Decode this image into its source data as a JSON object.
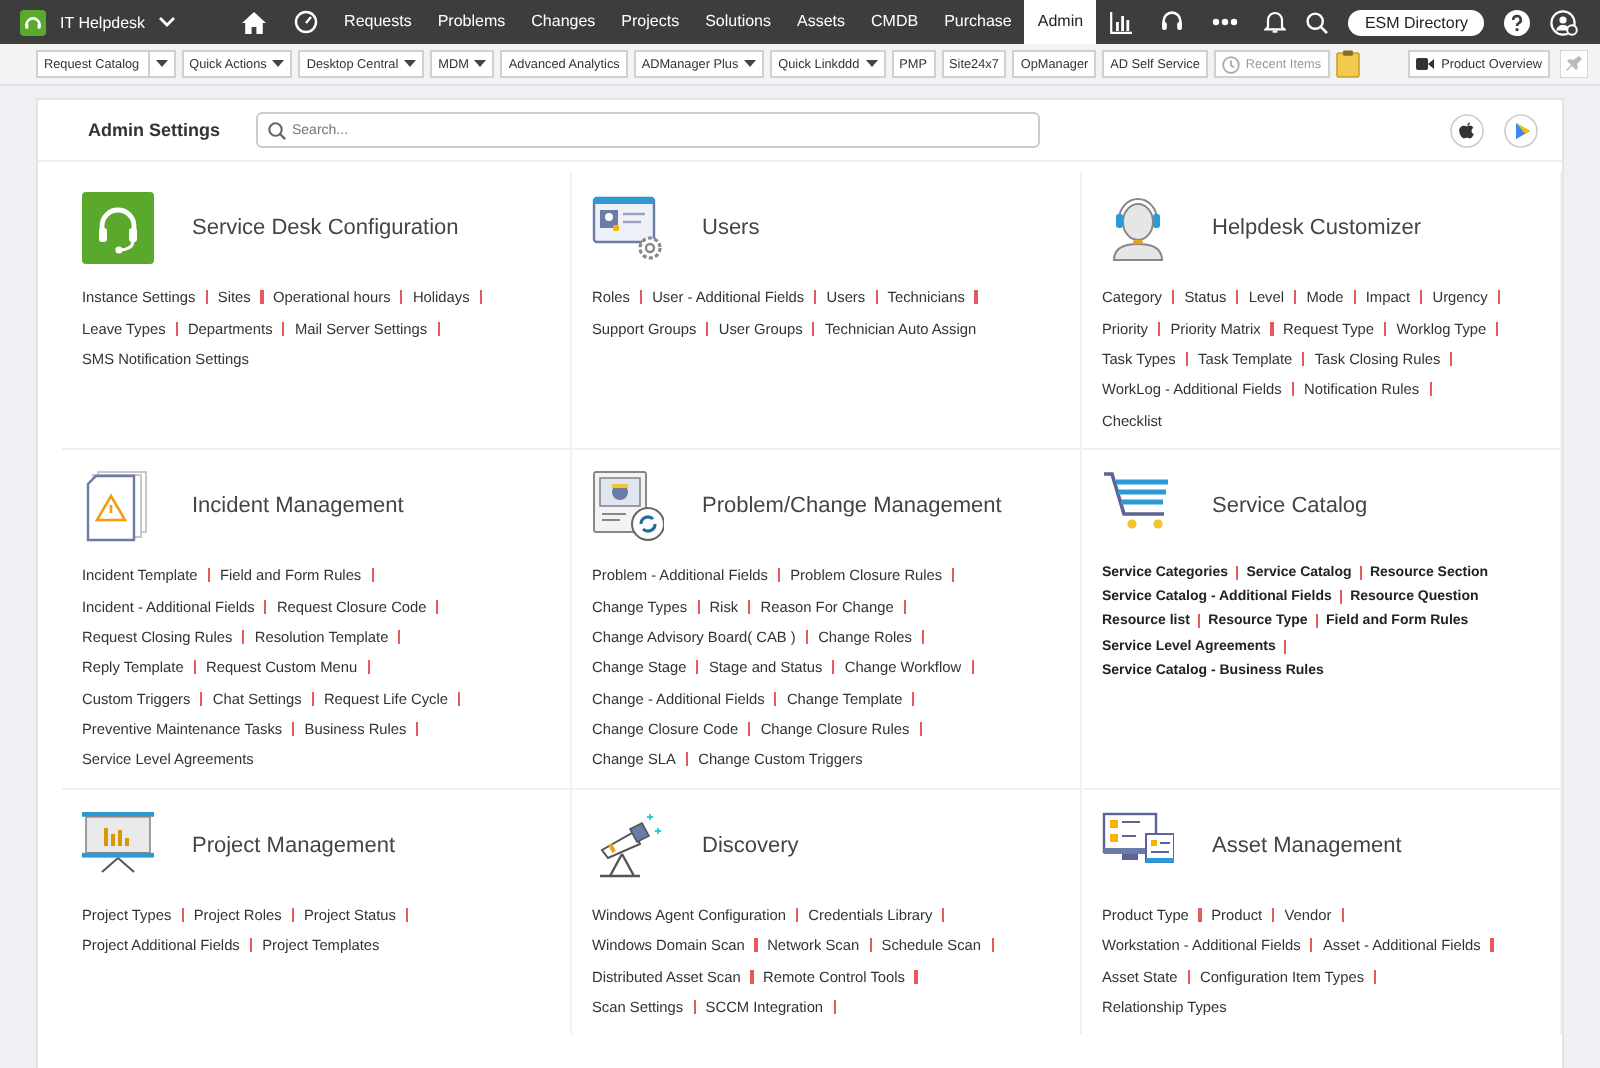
{
  "nav": {
    "app": "IT Helpdesk",
    "tabs": [
      {
        "label": "Requests",
        "selected": false
      },
      {
        "label": "Problems",
        "selected": false
      },
      {
        "label": "Changes",
        "selected": false
      },
      {
        "label": "Projects",
        "selected": false
      },
      {
        "label": "Solutions",
        "selected": false
      },
      {
        "label": "Assets",
        "selected": false
      },
      {
        "label": "CMDB",
        "selected": false
      },
      {
        "label": "Purchase",
        "selected": false
      },
      {
        "label": "Admin",
        "selected": true
      }
    ],
    "directory_button": "ESM Directory"
  },
  "toolbar": {
    "items": [
      {
        "label": "Request Catalog",
        "kind": "split"
      },
      {
        "label": "Quick Actions",
        "kind": "dropdown"
      },
      {
        "label": "Desktop Central",
        "kind": "dropdown"
      },
      {
        "label": "MDM",
        "kind": "dropdown"
      },
      {
        "label": "Advanced Analytics",
        "kind": "plain"
      },
      {
        "label": "ADManager Plus",
        "kind": "dropdown"
      },
      {
        "label": "Quick Linkddd",
        "kind": "dropdown"
      },
      {
        "label": "PMP",
        "kind": "plain"
      },
      {
        "label": "Site24x7",
        "kind": "plain"
      },
      {
        "label": "OpManager",
        "kind": "plain"
      },
      {
        "label": "AD Self Service",
        "kind": "plain"
      },
      {
        "label": "Recent Items",
        "kind": "recent"
      }
    ],
    "product_overview": "Product Overview"
  },
  "admin": {
    "title": "Admin Settings",
    "search": {
      "placeholder": "Search..."
    },
    "sections": [
      {
        "title": "Service Desk Configuration",
        "kind": "regular",
        "rows": [
          {
            "items": [
              "Instance Settings",
              "Sites",
              "Operational hours",
              "Holidays"
            ],
            "trailing": true
          },
          {
            "items": [
              "Leave Types",
              "Departments",
              "Mail Server Settings"
            ],
            "trailing": true
          },
          {
            "items": [
              "SMS Notification Settings"
            ],
            "trailing": false
          }
        ]
      },
      {
        "title": "Users",
        "kind": "regular",
        "rows": [
          {
            "items": [
              "Roles",
              "User - Additional Fields",
              "Users",
              "Technicians"
            ],
            "trailing": true
          },
          {
            "items": [
              "Support Groups",
              "User Groups",
              "Technician Auto Assign"
            ],
            "trailing": false
          }
        ]
      },
      {
        "title": "Helpdesk Customizer",
        "kind": "regular",
        "rows": [
          {
            "items": [
              "Category",
              "Status",
              "Level",
              "Mode",
              "Impact",
              "Urgency"
            ],
            "trailing": true
          },
          {
            "items": [
              "Priority",
              "Priority Matrix",
              "Request Type",
              "Worklog Type"
            ],
            "trailing": true
          },
          {
            "items": [
              "Task Types",
              "Task Template",
              "Task Closing Rules"
            ],
            "trailing": true
          },
          {
            "items": [
              "WorkLog - Additional Fields",
              "Notification Rules"
            ],
            "trailing": true
          },
          {
            "items": [
              "Checklist"
            ],
            "trailing": false
          }
        ]
      },
      {
        "title": "Incident Management",
        "kind": "regular",
        "rows": [
          {
            "items": [
              "Incident Template",
              "Field and Form Rules"
            ],
            "trailing": true
          },
          {
            "items": [
              "Incident - Additional Fields",
              "Request Closure Code"
            ],
            "trailing": true
          },
          {
            "items": [
              "Request Closing Rules",
              "Resolution Template"
            ],
            "trailing": true
          },
          {
            "items": [
              "Reply Template",
              "Request Custom Menu"
            ],
            "trailing": true
          },
          {
            "items": [
              "Custom Triggers",
              "Chat Settings",
              "Request Life Cycle"
            ],
            "trailing": true
          },
          {
            "items": [
              "Preventive Maintenance Tasks",
              "Business Rules"
            ],
            "trailing": true
          },
          {
            "items": [
              "Service Level Agreements"
            ],
            "trailing": false
          }
        ]
      },
      {
        "title": "Problem/Change Management",
        "kind": "regular",
        "rows": [
          {
            "items": [
              "Problem - Additional Fields",
              "Problem Closure Rules"
            ],
            "trailing": true
          },
          {
            "items": [
              "Change Types",
              "Risk",
              "Reason For Change"
            ],
            "trailing": true
          },
          {
            "items": [
              "Change Advisory Board( CAB )",
              "Change Roles"
            ],
            "trailing": true
          },
          {
            "items": [
              "Change Stage",
              "Stage and Status",
              "Change Workflow"
            ],
            "trailing": true
          },
          {
            "items": [
              "Change - Additional Fields",
              "Change Template"
            ],
            "trailing": true
          },
          {
            "items": [
              "Change Closure Code",
              "Change Closure Rules"
            ],
            "trailing": true
          },
          {
            "items": [
              "Change SLA",
              "Change Custom Triggers"
            ],
            "trailing": false
          }
        ]
      },
      {
        "title": "Service Catalog",
        "kind": "compact",
        "rows": [
          {
            "items": [
              "Service Categories",
              "Service Catalog",
              "Resource Section"
            ],
            "trailing": false
          },
          {
            "items": [
              "Service Catalog - Additional Fields",
              "Resource Question"
            ],
            "trailing": false
          },
          {
            "items": [
              "Resource list",
              "Resource Type",
              "Field and Form Rules"
            ],
            "trailing": false
          },
          {
            "items": [
              "Service Level Agreements"
            ],
            "trailing": true
          },
          {
            "items": [
              "Service Catalog - Business Rules"
            ],
            "trailing": false
          }
        ]
      },
      {
        "title": "Project Management",
        "kind": "regular",
        "rows": [
          {
            "items": [
              "Project Types",
              "Project Roles",
              "Project Status"
            ],
            "trailing": true
          },
          {
            "items": [
              "Project Additional Fields",
              "Project Templates"
            ],
            "trailing": false
          }
        ]
      },
      {
        "title": "Discovery",
        "kind": "regular",
        "rows": [
          {
            "items": [
              "Windows Agent Configuration",
              "Credentials Library"
            ],
            "trailing": true
          },
          {
            "items": [
              "Windows Domain Scan",
              "Network Scan",
              "Schedule Scan"
            ],
            "trailing": true
          },
          {
            "items": [
              "Distributed Asset Scan",
              "Remote Control Tools"
            ],
            "trailing": true
          },
          {
            "items": [
              "Scan Settings",
              "SCCM Integration"
            ],
            "trailing": true
          }
        ]
      },
      {
        "title": "Asset Management",
        "kind": "regular",
        "rows": [
          {
            "items": [
              "Product Type",
              "Product",
              "Vendor"
            ],
            "trailing": true
          },
          {
            "items": [
              "Workstation - Additional Fields",
              "Asset - Additional Fields"
            ],
            "trailing": true
          },
          {
            "items": [
              "Asset State",
              "Configuration Item Types"
            ],
            "trailing": true
          },
          {
            "items": [
              "Relationship Types"
            ],
            "trailing": false
          }
        ]
      }
    ]
  }
}
